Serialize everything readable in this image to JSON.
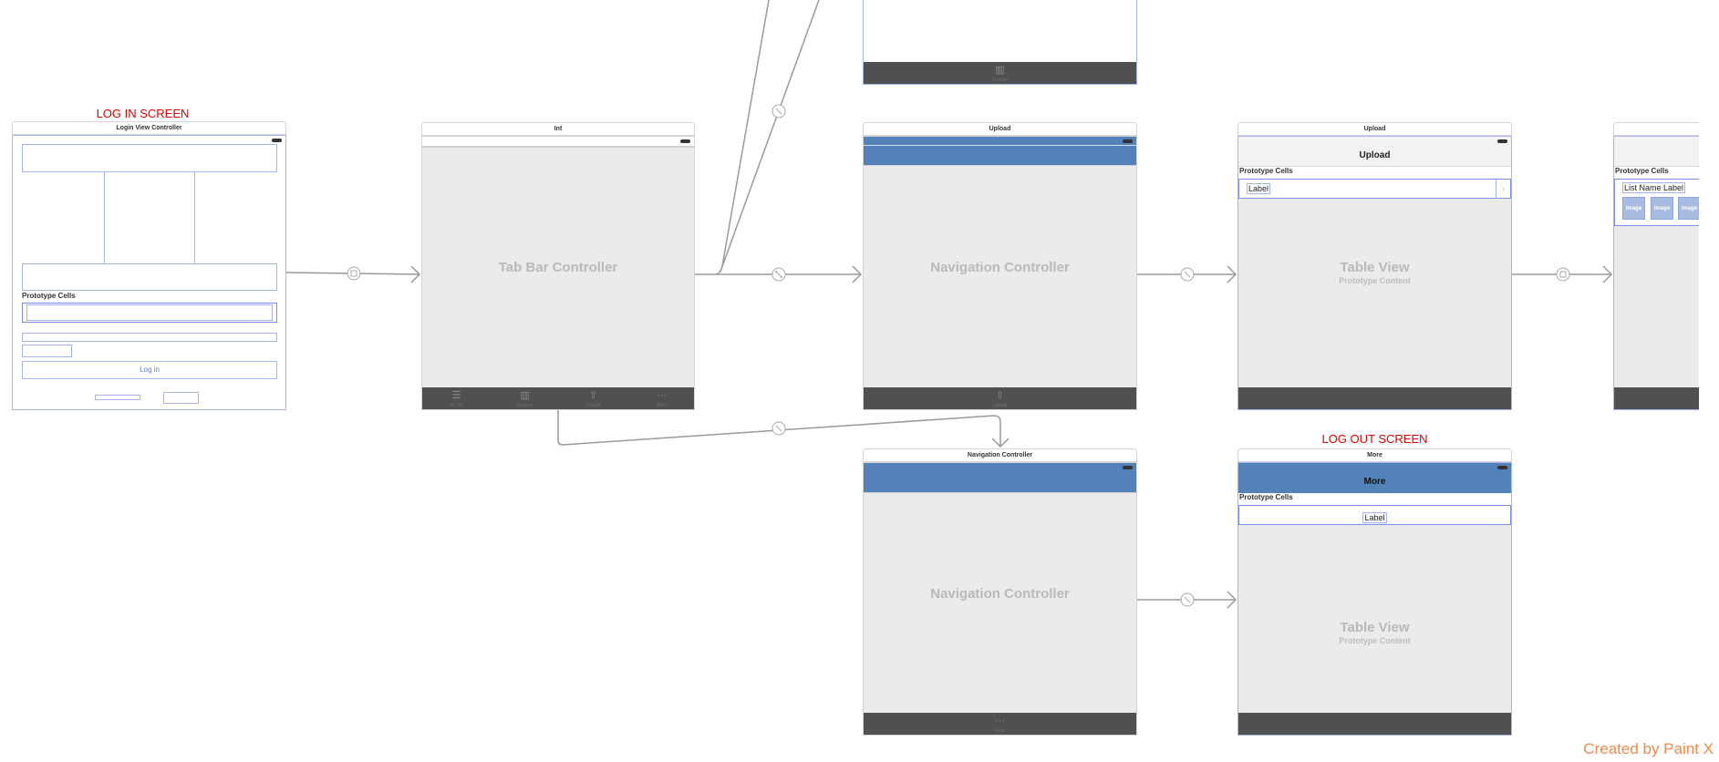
{
  "annotations": {
    "login_title": "LOG IN SCREEN",
    "logout_title": "LOG OUT SCREEN",
    "footer": "Created by Paint X",
    "annotation_color": "#e00000",
    "footer_color": "#f08a4b"
  },
  "scenes": {
    "login": {
      "title": "Login View Controller",
      "prototype_cells": "Prototype Cells",
      "login_button": "Log in"
    },
    "tab_bar": {
      "title": "Int",
      "center_label": "Tab Bar Controller",
      "tabs": [
        {
          "label": "My list",
          "icon": "list-icon"
        },
        {
          "label": "Scanner",
          "icon": "barcode-icon"
        },
        {
          "label": "Upload",
          "icon": "share-icon"
        },
        {
          "label": "More",
          "icon": "more-icon"
        }
      ]
    },
    "scanner": {
      "tab_label": "Scanner",
      "tab_icon": "barcode-icon"
    },
    "upload_nav": {
      "title": "Upload",
      "center_label": "Navigation Controller",
      "tab_label": "Upload",
      "tab_icon": "share-icon",
      "nav_color": "#5282b8"
    },
    "upload_table": {
      "title": "Upload",
      "nav_title": "Upload",
      "prototype_cells": "Prototype Cells",
      "cell_label": "Label",
      "center_label": "Table View",
      "sub_label": "Prototype Content"
    },
    "list_detail": {
      "prototype_cells": "Prototype Cells",
      "cell_label": "List Name Label",
      "images": [
        "Image",
        "Image",
        "Image"
      ]
    },
    "more_nav": {
      "title": "Navigation Controller",
      "center_label": "Navigation Controller",
      "tab_label": "More",
      "tab_icon": "more-icon"
    },
    "more_table": {
      "title": "More",
      "nav_title": "More",
      "prototype_cells": "Prototype Cells",
      "cell_label": "Label",
      "center_label": "Table View",
      "sub_label": "Prototype Content"
    }
  }
}
